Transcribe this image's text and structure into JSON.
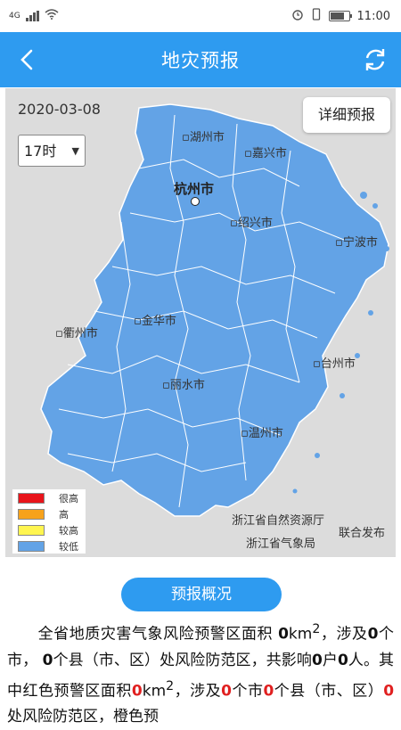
{
  "statusbar": {
    "network": "4G",
    "time": "11:00"
  },
  "appbar": {
    "title": "地灾预报"
  },
  "map": {
    "date": "2020-03-08",
    "hour": "17时",
    "detail_button": "详细预报",
    "cities": [
      {
        "name": "湖州市"
      },
      {
        "name": "嘉兴市"
      },
      {
        "name": "杭州市"
      },
      {
        "name": "绍兴市"
      },
      {
        "name": "宁波市"
      },
      {
        "name": "衢州市"
      },
      {
        "name": "金华市"
      },
      {
        "name": "台州市"
      },
      {
        "name": "丽水市"
      },
      {
        "name": "温州市"
      }
    ],
    "legend": [
      {
        "label": "很高",
        "color": "#e8141b"
      },
      {
        "label": "高",
        "color": "#f7a21b"
      },
      {
        "label": "较高",
        "color": "#fff54f"
      },
      {
        "label": "较低",
        "color": "#63a3e6"
      }
    ],
    "publisher1": "浙江省自然资源厅",
    "publisher2": "浙江省气象局",
    "publish_label": "联合发布",
    "province_color": "#63a3e6"
  },
  "summary": {
    "button": "预报概况",
    "t1": "全省地质灾害气象风险预警区面积 ",
    "area": "0",
    "unit": "km",
    "t2": "，涉及",
    "cities": "0",
    "t3": "个市，",
    "counties": "0",
    "t4": "个县（市、区）处风险防范区，共影响",
    "households": "0",
    "t5": "户",
    "people": "0",
    "t6": "人。其中红色预警区面积",
    "red_area": "0",
    "t7": "km",
    "t8": "，涉及",
    "red_cities": "0",
    "t9": "个市",
    "red_counties": "0",
    "t10": "个县（市、区）",
    "red_zones": "0",
    "t11": "处风险防范区，橙色预"
  }
}
